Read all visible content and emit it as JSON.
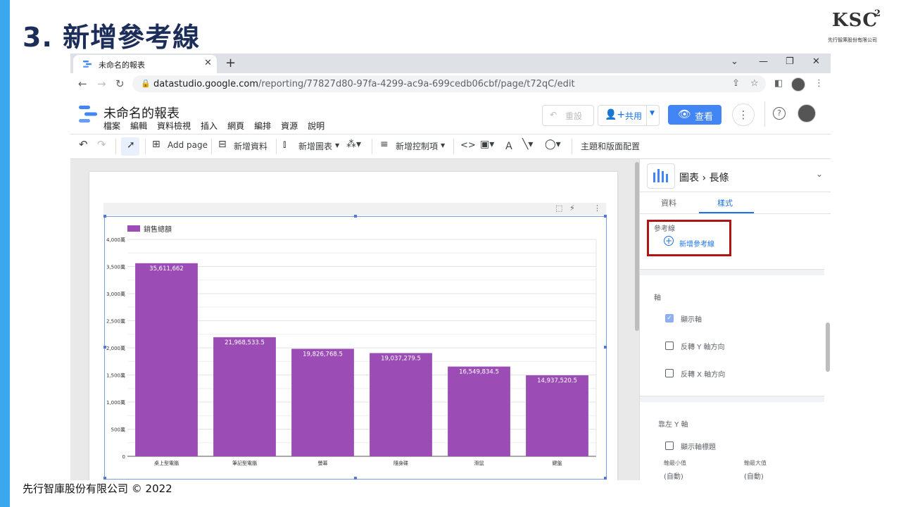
{
  "slide": {
    "title": "3. 新增參考線",
    "logo_text": "KSC",
    "logo_sup": "2",
    "logo_company": "先行智庫股份有限公司",
    "footer": "先行智庫股份有限公司 © 2022"
  },
  "browser": {
    "tab_title": "未命名的報表",
    "url_host": "datastudio.google.com",
    "url_path": "/reporting/77827d80-97fa-4299-ac9a-699cedb06cbf/page/t72qC/edit"
  },
  "app": {
    "report_title": "未命名的報表",
    "menu": [
      "檔案",
      "編輯",
      "資料檢視",
      "插入",
      "網頁",
      "編排",
      "資源",
      "說明"
    ],
    "reset_label": "重設",
    "share_label": "共用",
    "view_label": "查看"
  },
  "toolbar": {
    "add_page": "Add page",
    "add_data": "新增資料",
    "add_chart": "新增圖表",
    "add_control": "新增控制項",
    "theme_layout": "主題和版面配置"
  },
  "panel": {
    "crumb_chart": "圖表",
    "crumb_type": "長條",
    "tab_data": "資料",
    "tab_style": "樣式",
    "ref_lines_label": "參考線",
    "add_ref_line": "新增參考線",
    "axis_section": "軸",
    "show_axis": "顯示軸",
    "show_axis_checked": true,
    "reverse_y": "反轉 Y 軸方向",
    "reverse_x": "反轉 X 軸方向",
    "left_y_section": "靠左 Y 軸",
    "show_axis_title": "顯示軸標題",
    "axis_min": "軸最小值",
    "axis_max": "軸最大值",
    "auto_min": "(自動)",
    "auto_max": "(自動)"
  },
  "colors": {
    "bar": "#9b4db5",
    "accent": "#1a73e8",
    "highlight_border": "#b01515"
  },
  "chart_data": {
    "type": "bar",
    "legend": "銷售總額",
    "legend_position": "top-left",
    "categories": [
      "桌上型電腦",
      "筆記型電腦",
      "螢幕",
      "隨身碟",
      "滑鼠",
      "鍵盤"
    ],
    "values": [
      35611662,
      21968533.5,
      19826768.5,
      19037279.5,
      16549834.5,
      14937520.5
    ],
    "value_labels": [
      "35,611,662",
      "21,968,533.5",
      "19,826,768.5",
      "19,037,279.5",
      "16,549,834.5",
      "14,937,520.5"
    ],
    "yticks": [
      "0",
      "500萬",
      "1,000萬",
      "1,500萬",
      "2,000萬",
      "2,500萬",
      "3,000萬",
      "3,500萬",
      "4,000萬"
    ],
    "ylim": [
      0,
      40000000
    ],
    "grid": true
  }
}
